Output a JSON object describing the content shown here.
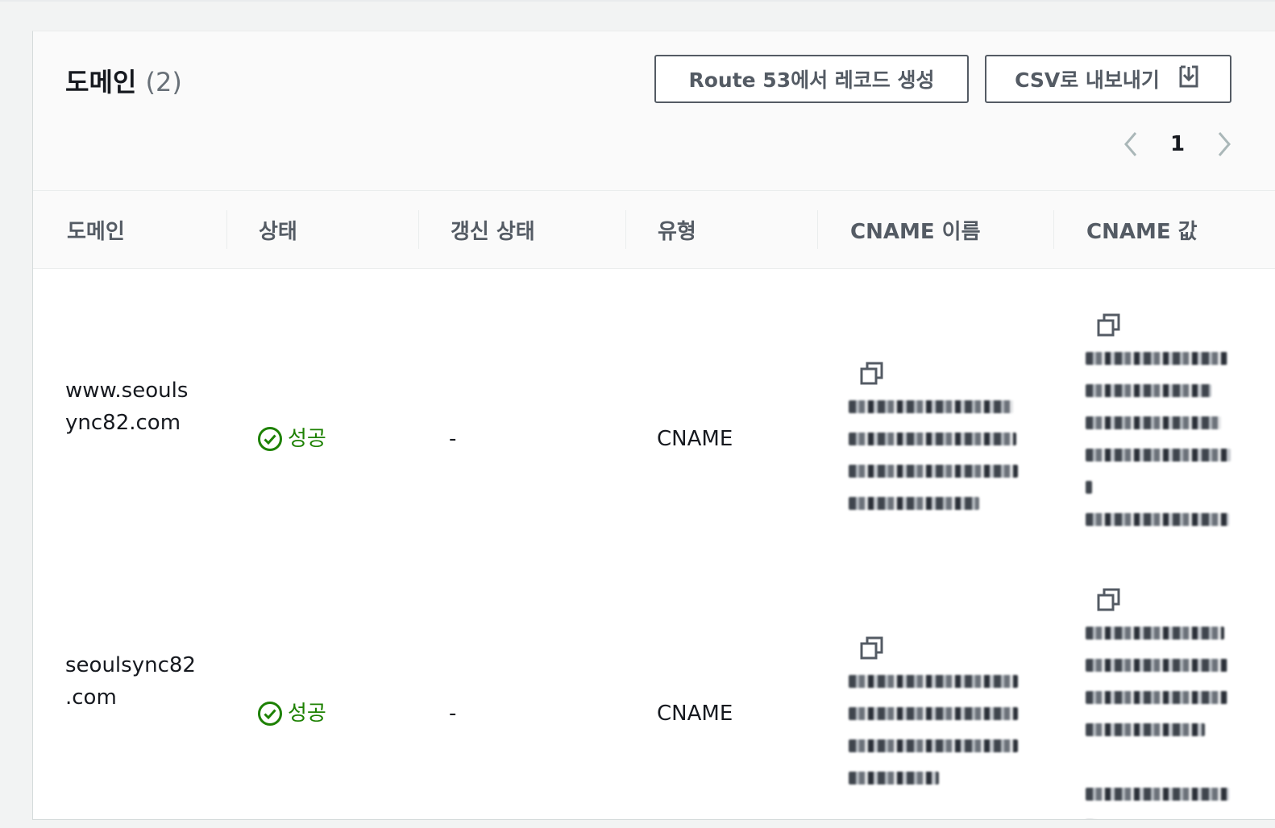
{
  "panel": {
    "title": "도메인",
    "title_count": "(2)",
    "buttons": {
      "route53": "Route 53에서 레코드 생성",
      "csv": "CSV로 내보내기"
    },
    "pagination": {
      "current_page": "1"
    }
  },
  "table": {
    "columns": [
      "도메인",
      "상태",
      "갱신 상태",
      "유형",
      "CNAME 이름",
      "CNAME 값"
    ],
    "rows": [
      {
        "domain_line1": "www.seouls",
        "domain_line2": "ync82.com",
        "status": "성공",
        "renewal_status": "-",
        "type": "CNAME"
      },
      {
        "domain_line1": "seoulsync82",
        "domain_line2": ".com",
        "status": "성공",
        "renewal_status": "-",
        "type": "CNAME"
      }
    ]
  },
  "colors": {
    "success": "#1d8102",
    "border": "#545b64",
    "header_bg": "#fafafa"
  }
}
